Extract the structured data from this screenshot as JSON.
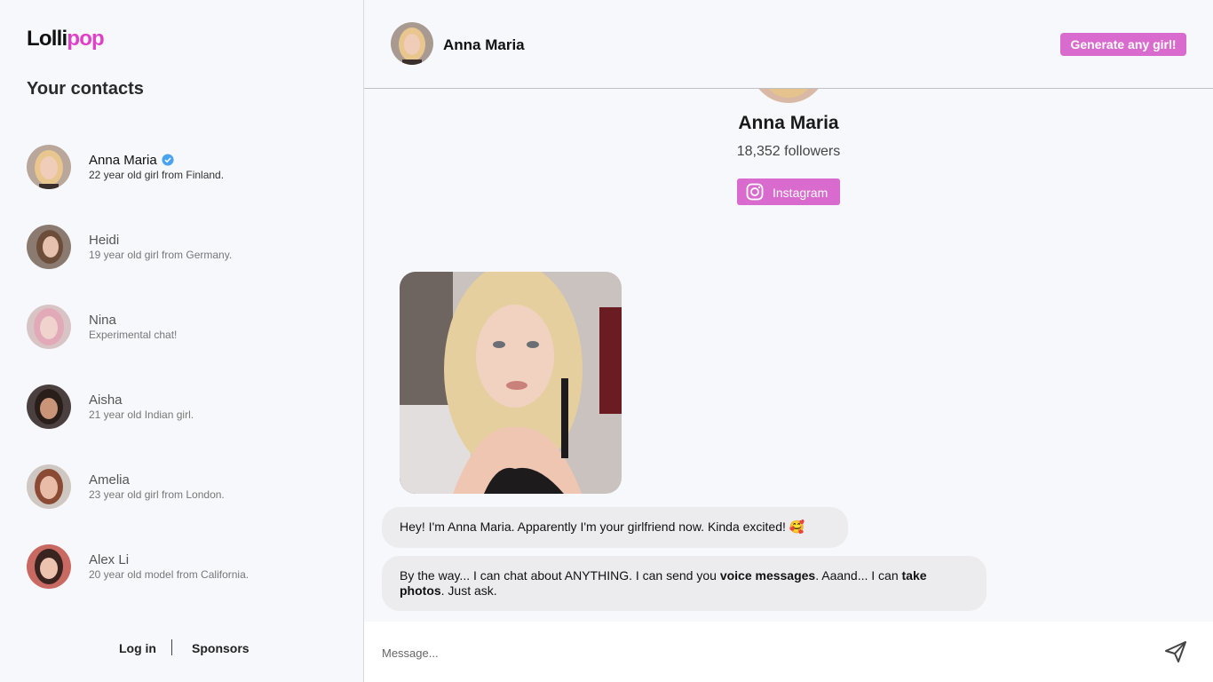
{
  "brand": {
    "logo_part1": "Lolli",
    "logo_part2": "pop"
  },
  "sidebar": {
    "title": "Your contacts",
    "contacts": [
      {
        "name": "Anna Maria",
        "subtitle": "22 year old girl from Finland.",
        "verified": true,
        "active": true
      },
      {
        "name": "Heidi",
        "subtitle": "19 year old girl from Germany."
      },
      {
        "name": "Nina",
        "subtitle": "Experimental chat!"
      },
      {
        "name": "Aisha",
        "subtitle": "21 year old Indian girl."
      },
      {
        "name": "Amelia",
        "subtitle": "23 year old girl from London."
      },
      {
        "name": "Alex Li",
        "subtitle": "20 year old model from California."
      }
    ],
    "footer": {
      "login": "Log in",
      "sponsors": "Sponsors"
    }
  },
  "header": {
    "name": "Anna Maria",
    "generate_button": "Generate any girl!"
  },
  "profile": {
    "name": "Anna Maria",
    "followers": "18,352 followers",
    "instagram_label": "Instagram"
  },
  "messages": {
    "m1": "Hey! I'm Anna Maria. Apparently I'm your girlfriend now. Kinda excited! 🥰",
    "m2_part1": "By the way... I can chat about ANYTHING. I can send you ",
    "m2_bold1": "voice messages",
    "m2_part2": ". Aaand... I can ",
    "m2_bold2": "take photos",
    "m2_part3": ". Just ask."
  },
  "composer": {
    "placeholder": "Message..."
  },
  "colors": {
    "accent": "#d86bcd",
    "logo_pink": "#e040c8",
    "bubble": "#ececee",
    "verified": "#4aa3f0"
  },
  "icons": {
    "verified": "verified-badge-icon",
    "instagram": "instagram-icon",
    "send": "send-icon"
  }
}
